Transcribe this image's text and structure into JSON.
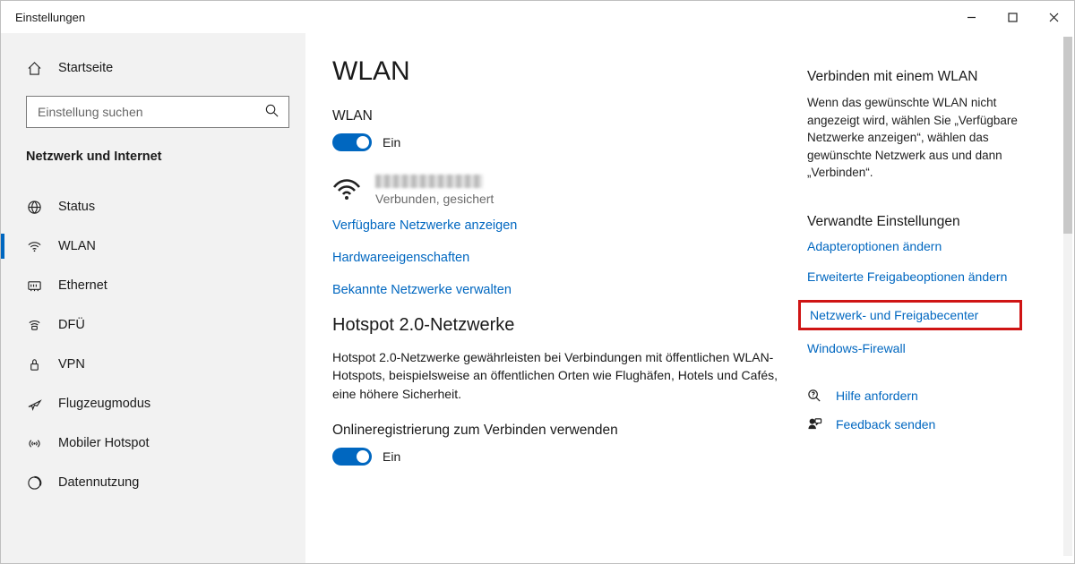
{
  "window": {
    "title": "Einstellungen"
  },
  "sidebar": {
    "home": "Startseite",
    "search_placeholder": "Einstellung suchen",
    "category": "Netzwerk und Internet",
    "items": [
      {
        "label": "Status"
      },
      {
        "label": "WLAN"
      },
      {
        "label": "Ethernet"
      },
      {
        "label": "DFÜ"
      },
      {
        "label": "VPN"
      },
      {
        "label": "Flugzeugmodus"
      },
      {
        "label": "Mobiler Hotspot"
      },
      {
        "label": "Datennutzung"
      }
    ]
  },
  "content": {
    "title": "WLAN",
    "wlan_label": "WLAN",
    "toggle_state": "Ein",
    "network_status": "Verbunden, gesichert",
    "links": {
      "available": "Verfügbare Netzwerke anzeigen",
      "hardware": "Hardwareeigenschaften",
      "known": "Bekannte Netzwerke verwalten"
    },
    "hotspot_title": "Hotspot 2.0-Netzwerke",
    "hotspot_para": "Hotspot 2.0-Netzwerke gewährleisten bei Verbindungen mit öffentlichen WLAN-Hotspots, beispielsweise an öffentlichen Orten wie Flughäfen, Hotels und Cafés, eine höhere Sicherheit.",
    "online_reg_label": "Onlineregistrierung zum Verbinden verwenden",
    "online_reg_state": "Ein"
  },
  "right": {
    "connect_heading": "Verbinden mit einem WLAN",
    "connect_text": "Wenn das gewünschte WLAN nicht angezeigt wird, wählen Sie „Verfügbare Netzwerke anzeigen“, wählen das gewünschte Netzwerk aus und dann „Verbinden“.",
    "related_heading": "Verwandte Einstellungen",
    "links": {
      "adapter": "Adapteroptionen ändern",
      "sharing": "Erweiterte Freigabeoptionen ändern",
      "center": "Netzwerk- und Freigabecenter",
      "firewall": "Windows-Firewall"
    },
    "help": "Hilfe anfordern",
    "feedback": "Feedback senden"
  }
}
